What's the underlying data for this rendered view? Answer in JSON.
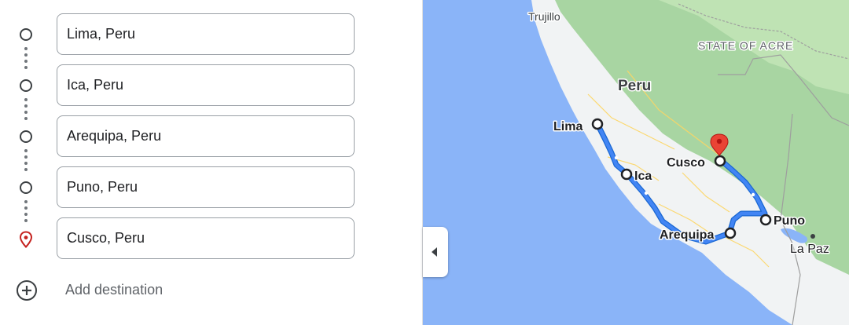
{
  "directions": {
    "stops": [
      {
        "value": "Lima, Peru",
        "type": "waypoint"
      },
      {
        "value": "Ica, Peru",
        "type": "waypoint"
      },
      {
        "value": "Arequipa, Peru",
        "type": "waypoint"
      },
      {
        "value": "Puno, Peru",
        "type": "waypoint"
      },
      {
        "value": "Cusco, Peru",
        "type": "destination"
      }
    ],
    "add_destination_label": "Add destination"
  },
  "map": {
    "labels": {
      "trujillo": "Trujillo",
      "acre": "STATE OF ACRE",
      "peru": "Peru",
      "lima": "Lima",
      "ica": "Ica",
      "cusco": "Cusco",
      "puno": "Puno",
      "arequipa": "Arequipa",
      "la_paz": "La Paz"
    },
    "route_color": "#4285f4",
    "pin_color": "#ea4335",
    "ocean_color": "#8ab4f8",
    "land_color": "#f1f3f4",
    "forest_color": "#a8d5a2"
  },
  "icons": {
    "waypoint": "circle-outline-icon",
    "destination": "location-pin-icon",
    "add": "add-circle-icon",
    "collapse": "chevron-left-icon"
  }
}
